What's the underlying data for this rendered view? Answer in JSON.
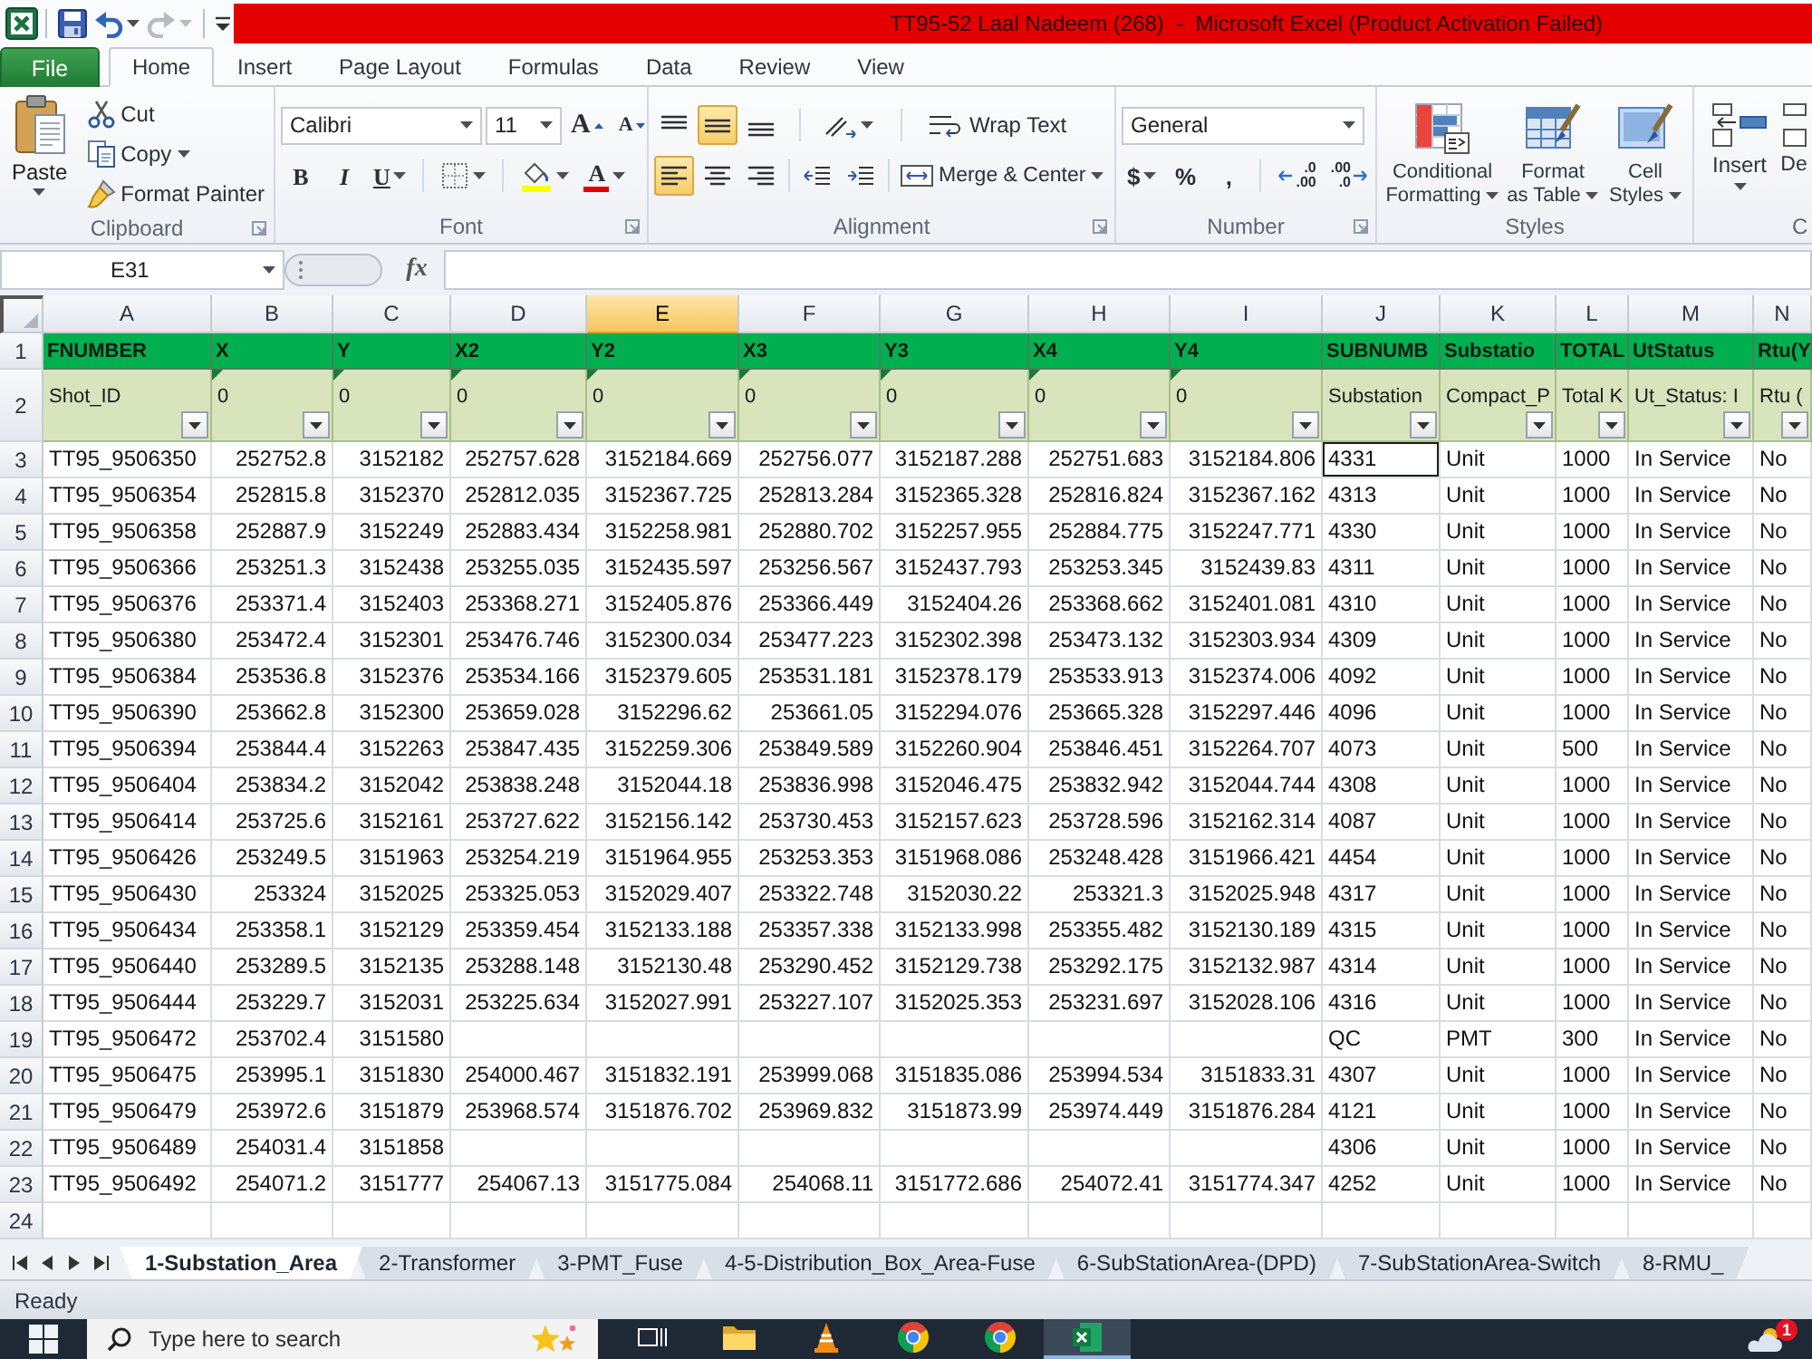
{
  "title_bar": {
    "title": "TT95-52 Laal Nadeem (268)  -  Microsoft Excel (Product Activation Failed)",
    "quick_access": [
      {
        "kind": "save",
        "disabled": false
      },
      {
        "kind": "undo",
        "disabled": false
      },
      {
        "kind": "redo",
        "disabled": true
      }
    ]
  },
  "ribbon_tabs": [
    {
      "label": "File",
      "kind": "file",
      "selected": false
    },
    {
      "label": "Home",
      "kind": "tab",
      "selected": true
    },
    {
      "label": "Insert",
      "kind": "tab",
      "selected": false
    },
    {
      "label": "Page Layout",
      "kind": "tab",
      "selected": false
    },
    {
      "label": "Formulas",
      "kind": "tab",
      "selected": false
    },
    {
      "label": "Data",
      "kind": "tab",
      "selected": false
    },
    {
      "label": "Review",
      "kind": "tab",
      "selected": false
    },
    {
      "label": "View",
      "kind": "tab",
      "selected": false
    }
  ],
  "ribbon_groups": [
    {
      "kind": "clipboard",
      "label": "Clipboard",
      "paste": "Paste",
      "cut": "Cut",
      "copy": "Copy",
      "format_painter": "Format Painter"
    },
    {
      "kind": "font",
      "label": "Font",
      "font_name": "Calibri",
      "font_size": "11",
      "grow": "A",
      "shrink": "A",
      "bold": "B",
      "italic": "I",
      "underline": "U",
      "font_color": "A"
    },
    {
      "kind": "alignment",
      "label": "Alignment",
      "vertical": [
        {
          "kind": "top",
          "selected": false
        },
        {
          "kind": "middle",
          "selected": true
        },
        {
          "kind": "bottom",
          "selected": false
        }
      ],
      "horizontal": [
        {
          "kind": "left",
          "selected": true
        },
        {
          "kind": "center",
          "selected": false
        },
        {
          "kind": "right",
          "selected": false
        }
      ],
      "wrap_text": "Wrap Text",
      "merge": "Merge & Center"
    },
    {
      "kind": "number",
      "label": "Number",
      "format": "General",
      "currency": "$",
      "percent": "%",
      "comma": ",",
      "increase_decimal": ".0\n.00",
      "decrease_decimal": ".00\n.0"
    },
    {
      "kind": "styles",
      "label": "Styles",
      "buttons": [
        {
          "kind": "conditional",
          "label": "Conditional\nFormatting"
        },
        {
          "kind": "table",
          "label": "Format\nas Table"
        },
        {
          "kind": "cell",
          "label": "Cell\nStyles"
        }
      ]
    },
    {
      "kind": "cells",
      "label": "C",
      "buttons": [
        {
          "kind": "insert",
          "label": "Insert"
        },
        {
          "kind": "delete",
          "label": "De"
        }
      ]
    }
  ],
  "formula_bar": {
    "name_box": "E31",
    "function_label": "fx"
  },
  "sheet": {
    "columns": [
      {
        "letter": "A",
        "kind": "text",
        "selected": false
      },
      {
        "letter": "B",
        "kind": "number",
        "selected": false
      },
      {
        "letter": "C",
        "kind": "number",
        "selected": false
      },
      {
        "letter": "D",
        "kind": "number",
        "selected": false
      },
      {
        "letter": "E",
        "kind": "number",
        "selected": true
      },
      {
        "letter": "F",
        "kind": "number",
        "selected": false
      },
      {
        "letter": "G",
        "kind": "number",
        "selected": false
      },
      {
        "letter": "H",
        "kind": "number",
        "selected": false
      },
      {
        "letter": "I",
        "kind": "number",
        "selected": false
      },
      {
        "letter": "J",
        "kind": "text",
        "selected": false
      },
      {
        "letter": "K",
        "kind": "text",
        "selected": false
      },
      {
        "letter": "L",
        "kind": "text",
        "selected": false
      },
      {
        "letter": "M",
        "kind": "text",
        "selected": false
      },
      {
        "letter": "N",
        "kind": "text",
        "selected": false
      }
    ],
    "header_row": {
      "number": "1",
      "cells": [
        "FNUMBER",
        "X",
        "Y",
        "X2",
        "Y2",
        "X3",
        "Y3",
        "X4",
        "Y4",
        "SUBNUMB",
        "Substatio",
        "TOTAL",
        "UtStatus",
        "Rtu(Y"
      ]
    },
    "filter_row": {
      "number": "2",
      "cells": [
        {
          "text": "Shot_ID",
          "flagged": false
        },
        {
          "text": "0",
          "flagged": true
        },
        {
          "text": "0",
          "flagged": true
        },
        {
          "text": "0",
          "flagged": true
        },
        {
          "text": "0",
          "flagged": true
        },
        {
          "text": "0",
          "flagged": true
        },
        {
          "text": "0",
          "flagged": true
        },
        {
          "text": "0",
          "flagged": true
        },
        {
          "text": "0",
          "flagged": true
        },
        {
          "text": "Substation",
          "flagged": false
        },
        {
          "text": "Compact_P",
          "flagged": false
        },
        {
          "text": "Total K",
          "flagged": false
        },
        {
          "text": "Ut_Status: I",
          "flagged": false
        },
        {
          "text": "Rtu (",
          "flagged": false
        }
      ]
    },
    "rows": [
      {
        "number": "3",
        "cells": [
          "TT95_9506350",
          "252752.8",
          "3152182",
          "252757.628",
          "3152184.669",
          "252756.077",
          "3152187.288",
          "252751.683",
          "3152184.806",
          {
            "text": "4331",
            "outlined": true
          },
          "Unit",
          "1000",
          "In Service",
          "No"
        ]
      },
      {
        "number": "4",
        "cells": [
          "TT95_9506354",
          "252815.8",
          "3152370",
          "252812.035",
          "3152367.725",
          "252813.284",
          "3152365.328",
          "252816.824",
          "3152367.162",
          "4313",
          "Unit",
          "1000",
          "In Service",
          "No"
        ]
      },
      {
        "number": "5",
        "cells": [
          "TT95_9506358",
          "252887.9",
          "3152249",
          "252883.434",
          "3152258.981",
          "252880.702",
          "3152257.955",
          "252884.775",
          "3152247.771",
          "4330",
          "Unit",
          "1000",
          "In Service",
          "No"
        ]
      },
      {
        "number": "6",
        "cells": [
          "TT95_9506366",
          "253251.3",
          "3152438",
          "253255.035",
          "3152435.597",
          "253256.567",
          "3152437.793",
          "253253.345",
          "3152439.83",
          "4311",
          "Unit",
          "1000",
          "In Service",
          "No"
        ]
      },
      {
        "number": "7",
        "cells": [
          "TT95_9506376",
          "253371.4",
          "3152403",
          "253368.271",
          "3152405.876",
          "253366.449",
          "3152404.26",
          "253368.662",
          "3152401.081",
          "4310",
          "Unit",
          "1000",
          "In Service",
          "No"
        ]
      },
      {
        "number": "8",
        "cells": [
          "TT95_9506380",
          "253472.4",
          "3152301",
          "253476.746",
          "3152300.034",
          "253477.223",
          "3152302.398",
          "253473.132",
          "3152303.934",
          "4309",
          "Unit",
          "1000",
          "In Service",
          "No"
        ]
      },
      {
        "number": "9",
        "cells": [
          "TT95_9506384",
          "253536.8",
          "3152376",
          "253534.166",
          "3152379.605",
          "253531.181",
          "3152378.179",
          "253533.913",
          "3152374.006",
          "4092",
          "Unit",
          "1000",
          "In Service",
          "No"
        ]
      },
      {
        "number": "10",
        "cells": [
          "TT95_9506390",
          "253662.8",
          "3152300",
          "253659.028",
          "3152296.62",
          "253661.05",
          "3152294.076",
          "253665.328",
          "3152297.446",
          "4096",
          "Unit",
          "1000",
          "In Service",
          "No"
        ]
      },
      {
        "number": "11",
        "cells": [
          "TT95_9506394",
          "253844.4",
          "3152263",
          "253847.435",
          "3152259.306",
          "253849.589",
          "3152260.904",
          "253846.451",
          "3152264.707",
          "4073",
          "Unit",
          "500",
          "In Service",
          "No"
        ]
      },
      {
        "number": "12",
        "cells": [
          "TT95_9506404",
          "253834.2",
          "3152042",
          "253838.248",
          "3152044.18",
          "253836.998",
          "3152046.475",
          "253832.942",
          "3152044.744",
          "4308",
          "Unit",
          "1000",
          "In Service",
          "No"
        ]
      },
      {
        "number": "13",
        "cells": [
          "TT95_9506414",
          "253725.6",
          "3152161",
          "253727.622",
          "3152156.142",
          "253730.453",
          "3152157.623",
          "253728.596",
          "3152162.314",
          "4087",
          "Unit",
          "1000",
          "In Service",
          "No"
        ]
      },
      {
        "number": "14",
        "cells": [
          "TT95_9506426",
          "253249.5",
          "3151963",
          "253254.219",
          "3151964.955",
          "253253.353",
          "3151968.086",
          "253248.428",
          "3151966.421",
          "4454",
          "Unit",
          "1000",
          "In Service",
          "No"
        ]
      },
      {
        "number": "15",
        "cells": [
          "TT95_9506430",
          "253324",
          "3152025",
          "253325.053",
          "3152029.407",
          "253322.748",
          "3152030.22",
          "253321.3",
          "3152025.948",
          "4317",
          "Unit",
          "1000",
          "In Service",
          "No"
        ]
      },
      {
        "number": "16",
        "cells": [
          "TT95_9506434",
          "253358.1",
          "3152129",
          "253359.454",
          "3152133.188",
          "253357.338",
          "3152133.998",
          "253355.482",
          "3152130.189",
          "4315",
          "Unit",
          "1000",
          "In Service",
          "No"
        ]
      },
      {
        "number": "17",
        "cells": [
          "TT95_9506440",
          "253289.5",
          "3152135",
          "253288.148",
          "3152130.48",
          "253290.452",
          "3152129.738",
          "253292.175",
          "3152132.987",
          "4314",
          "Unit",
          "1000",
          "In Service",
          "No"
        ]
      },
      {
        "number": "18",
        "cells": [
          "TT95_9506444",
          "253229.7",
          "3152031",
          "253225.634",
          "3152027.991",
          "253227.107",
          "3152025.353",
          "253231.697",
          "3152028.106",
          "4316",
          "Unit",
          "1000",
          "In Service",
          "No"
        ]
      },
      {
        "number": "19",
        "cells": [
          "TT95_9506472",
          "253702.4",
          "3151580",
          null,
          null,
          null,
          null,
          null,
          null,
          "QC",
          "PMT",
          "300",
          "In Service",
          "No"
        ]
      },
      {
        "number": "20",
        "cells": [
          "TT95_9506475",
          "253995.1",
          "3151830",
          "254000.467",
          "3151832.191",
          "253999.068",
          "3151835.086",
          "253994.534",
          "3151833.31",
          "4307",
          "Unit",
          "1000",
          "In Service",
          "No"
        ]
      },
      {
        "number": "21",
        "cells": [
          "TT95_9506479",
          "253972.6",
          "3151879",
          "253968.574",
          "3151876.702",
          "253969.832",
          "3151873.99",
          "253974.449",
          "3151876.284",
          "4121",
          "Unit",
          "1000",
          "In Service",
          "No"
        ]
      },
      {
        "number": "22",
        "cells": [
          "TT95_9506489",
          "254031.4",
          "3151858",
          null,
          null,
          null,
          null,
          null,
          null,
          "4306",
          "Unit",
          "1000",
          "In Service",
          "No"
        ]
      },
      {
        "number": "23",
        "cells": [
          "TT95_9506492",
          "254071.2",
          "3151777",
          "254067.13",
          "3151775.084",
          "254068.11",
          "3151772.686",
          "254072.41",
          "3151774.347",
          "4252",
          "Unit",
          "1000",
          "In Service",
          "No"
        ]
      },
      {
        "number": "24"
      }
    ]
  },
  "sheet_tabs": [
    {
      "label": "1-Substation_Area",
      "selected": true
    },
    {
      "label": "2-Transformer",
      "selected": false
    },
    {
      "label": "3-PMT_Fuse",
      "selected": false
    },
    {
      "label": "4-5-Distribution_Box_Area-Fuse",
      "selected": false
    },
    {
      "label": "6-SubStationArea-(DPD)",
      "selected": false
    },
    {
      "label": "7-SubStationArea-Switch",
      "selected": false
    },
    {
      "label": "8-RMU_",
      "selected": false
    }
  ],
  "status_bar": {
    "text": "Ready"
  },
  "taskbar": {
    "placeholder": "Type here to search",
    "apps": [
      {
        "kind": "task_view",
        "selected": false
      },
      {
        "kind": "explorer",
        "selected": false
      },
      {
        "kind": "media",
        "selected": false
      },
      {
        "kind": "browser",
        "selected": false
      },
      {
        "kind": "browser",
        "selected": false
      },
      {
        "kind": "spreadsheet",
        "selected": true
      }
    ],
    "badge": "1"
  }
}
